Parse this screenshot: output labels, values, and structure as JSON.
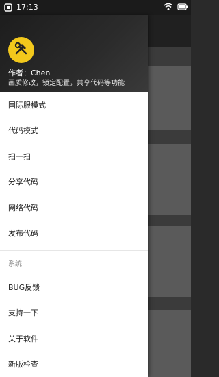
{
  "status_bar": {
    "time": "17:13"
  },
  "drawer": {
    "author_line": "作者：Chen",
    "description": "画质修改，锁定配置，共享代码等功能",
    "items": [
      {
        "label": "国际服模式"
      },
      {
        "label": "代码模式"
      },
      {
        "label": "扫一扫"
      },
      {
        "label": "分享代码"
      },
      {
        "label": "网络代码"
      },
      {
        "label": "发布代码"
      }
    ],
    "section_title": "系统",
    "system_items": [
      {
        "label": "BUG反馈"
      },
      {
        "label": "支持一下"
      },
      {
        "label": "关于软件"
      },
      {
        "label": "新版检查"
      }
    ]
  },
  "colors": {
    "avatar_bg": "#f2c81c",
    "header_bg": "#1d1d1d"
  }
}
